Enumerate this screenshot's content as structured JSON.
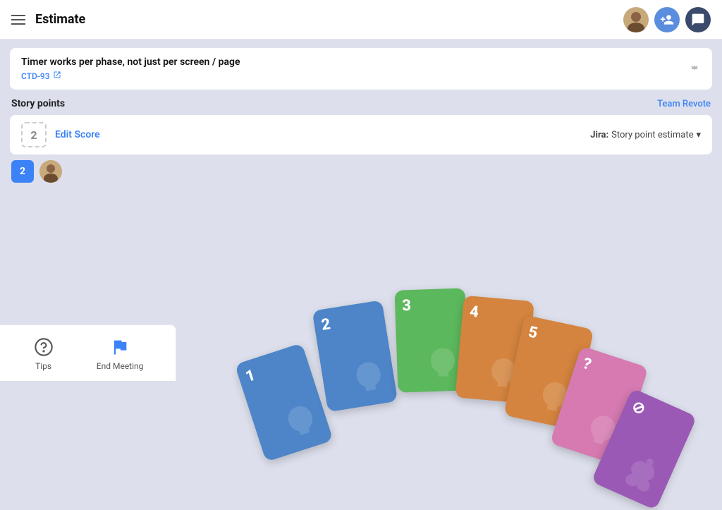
{
  "header": {
    "menu_icon": "menu-icon",
    "title": "Estimate",
    "avatar_alt": "user avatar",
    "add_people_icon": "add-people-icon",
    "messages_icon": "messages-icon"
  },
  "issue": {
    "title": "Timer works per phase, not just per screen / page",
    "id": "CTD-93",
    "external_link": "↗",
    "collapse_icon": "⌃"
  },
  "story_points": {
    "section_title": "Story points",
    "team_revote": "Team Revote",
    "score_badge": "2",
    "edit_score": "Edit Score",
    "jira_label": "Jira:",
    "jira_field": "Story point estimate",
    "jira_chevron": "▾",
    "voter_score": "2"
  },
  "cards": [
    {
      "value": "1",
      "color": "#4d85c8"
    },
    {
      "value": "2",
      "color": "#4d85c8"
    },
    {
      "value": "3",
      "color": "#5cb85c"
    },
    {
      "value": "4",
      "color": "#d4843e"
    },
    {
      "value": "5",
      "color": "#d4843e"
    },
    {
      "value": "?",
      "color": "#d67ab1"
    },
    {
      "value": "⊘",
      "color": "#9b59b6"
    }
  ],
  "bottom_bar": {
    "tips_icon": "question-circle-icon",
    "tips_label": "Tips",
    "end_meeting_icon": "flag-icon",
    "end_meeting_label": "End Meeting"
  }
}
